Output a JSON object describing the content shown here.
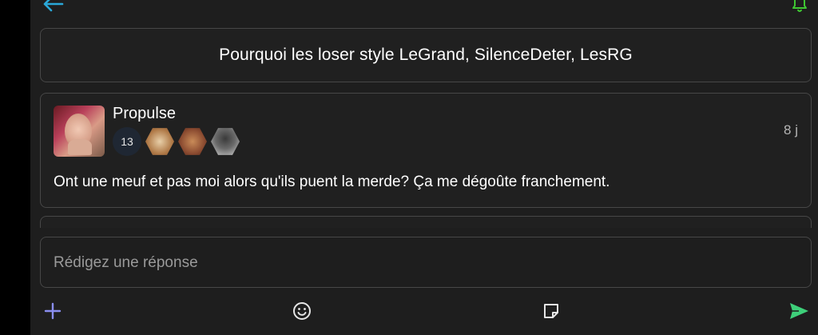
{
  "topic": {
    "title": "Pourquoi les loser style LeGrand, SilenceDeter, LesRG"
  },
  "post": {
    "username": "Propulse",
    "badge_count": "13",
    "timestamp": "8 j",
    "body": "Ont une meuf et pas moi alors qu'ils puent la merde? Ça me dégoûte franchement."
  },
  "reply": {
    "placeholder": "Rédigez une réponse"
  },
  "colors": {
    "accent_back": "#2aa8d8",
    "accent_bell": "#3fc832",
    "plus": "#8a8ef0",
    "send": "#3ed07a"
  },
  "icons": [
    "back-arrow-icon",
    "bell-icon",
    "plus-icon",
    "emoji-icon",
    "sticky-note-icon",
    "send-icon"
  ]
}
